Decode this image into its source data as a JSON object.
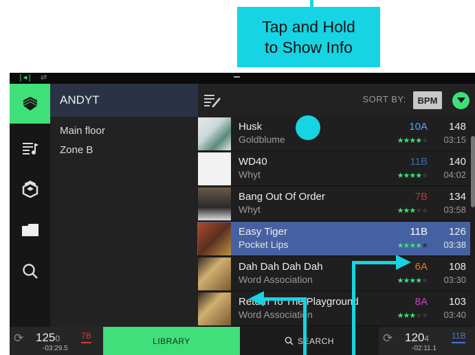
{
  "callout": {
    "line1": "Tap and Hold",
    "line2": "to Show Info"
  },
  "colors": {
    "accent_green": "#3fe07a",
    "callout_cyan": "#16d4e4",
    "selected_row": "#4661a1"
  },
  "nav": {
    "items": [
      {
        "name": "crates",
        "icon": "crate-icon",
        "active": true
      },
      {
        "name": "playlists",
        "icon": "playlist-icon",
        "active": false
      },
      {
        "name": "engine-prime",
        "icon": "engine-logo-icon",
        "active": false
      },
      {
        "name": "files",
        "icon": "folder-icon",
        "active": false
      },
      {
        "name": "search",
        "icon": "search-icon",
        "active": false
      }
    ]
  },
  "crates": {
    "header": "ANDYT",
    "items": [
      "Main floor",
      "Zone B"
    ]
  },
  "tracks_header": {
    "sort_label": "SORT BY:",
    "sort_value": "BPM"
  },
  "tracks": [
    {
      "title": "Husk",
      "artist": "Goldblume",
      "key": "10A",
      "key_color": "#5aa0ff",
      "rating": 4,
      "bpm": "148",
      "time": "03:15"
    },
    {
      "title": "WD40",
      "artist": "Whyt",
      "key": "11B",
      "key_color": "#3a6bb0",
      "rating": 4,
      "bpm": "140",
      "time": "04:02"
    },
    {
      "title": "Bang Out Of Order",
      "artist": "Whyt",
      "key": "7B",
      "key_color": "#c03535",
      "rating": 3,
      "bpm": "134",
      "time": "03:58"
    },
    {
      "title": "Easy Tiger",
      "artist": "Pocket Lips",
      "key": "11B",
      "key_color": "#ffffff",
      "rating": 4,
      "bpm": "126",
      "time": "03:38"
    },
    {
      "title": "Dah Dah Dah Dah",
      "artist": "Word Association",
      "key": "6A",
      "key_color": "#e07a2a",
      "rating": 4,
      "bpm": "108",
      "time": "03:30"
    },
    {
      "title": "Return To The Playground",
      "artist": "Word Association",
      "key": "8A",
      "key_color": "#d040c8",
      "rating": 3,
      "bpm": "103",
      "time": "03:40"
    }
  ],
  "bottom": {
    "left_deck": {
      "bpm": "125",
      "bpm_dec": "0",
      "time": "-03:29.5",
      "key": "7B",
      "key_color": "#d03a3a"
    },
    "library_label": "LIBRARY",
    "search_label": "SEARCH",
    "right_deck": {
      "bpm": "120",
      "bpm_dec": "4",
      "time": "-02:11.1",
      "key": "11B",
      "key_color": "#4a7ad0"
    }
  }
}
